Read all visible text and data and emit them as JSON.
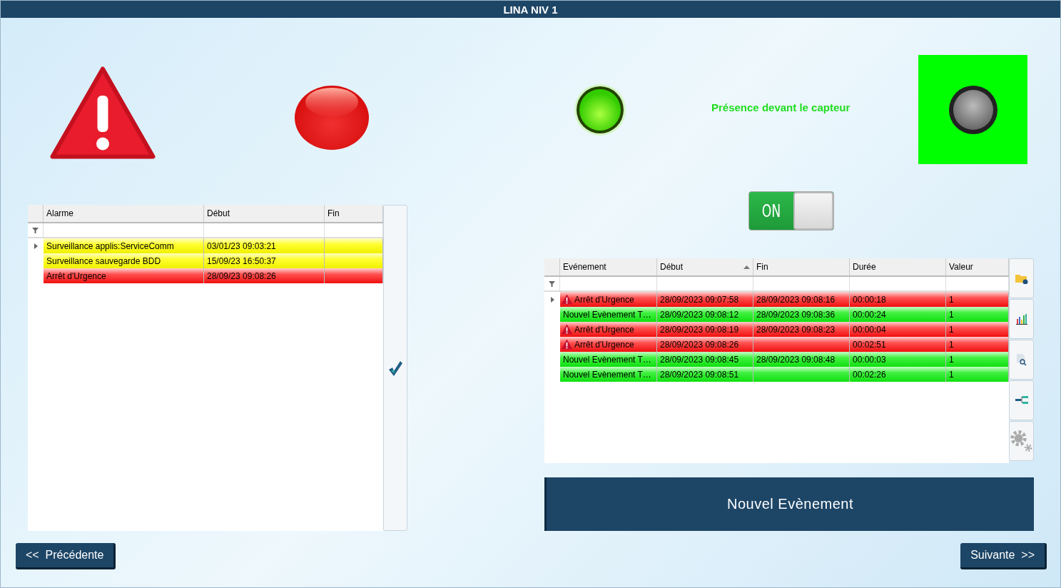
{
  "window": {
    "title": "LINA NIV 1"
  },
  "sensor": {
    "label": "Présence devant le capteur",
    "lit": true
  },
  "toggle": {
    "label": "ON",
    "on": true
  },
  "alarms": {
    "columns": [
      {
        "label": "Alarme"
      },
      {
        "label": "Début"
      },
      {
        "label": "Fin"
      }
    ],
    "rows": [
      {
        "kind": "warning",
        "cells": [
          "Surveillance applis:ServiceComm",
          "03/01/23 09:03:21",
          ""
        ]
      },
      {
        "kind": "warning",
        "cells": [
          "Surveillance sauvegarde BDD",
          "15/09/23 16:50:37",
          ""
        ]
      },
      {
        "kind": "alarm",
        "cells": [
          "Arrêt d'Urgence",
          "28/09/23 09:08:26",
          ""
        ]
      }
    ]
  },
  "events": {
    "columns": [
      {
        "label": "Evénement",
        "sorted": false
      },
      {
        "label": "Début",
        "sorted": true
      },
      {
        "label": "Fin",
        "sorted": false
      },
      {
        "label": "Durée",
        "sorted": false
      },
      {
        "label": "Valeur",
        "sorted": false
      }
    ],
    "rows": [
      {
        "kind": "alarm",
        "cells": [
          "Arrêt d'Urgence",
          "28/09/2023 09:07:58",
          "28/09/2023 09:08:16",
          "00:00:18",
          "1"
        ]
      },
      {
        "kind": "event",
        "cells": [
          "Nouvel Evènement T…",
          "28/09/2023 09:08:12",
          "28/09/2023 09:08:36",
          "00:00:24",
          "1"
        ]
      },
      {
        "kind": "alarm",
        "cells": [
          "Arrêt d'Urgence",
          "28/09/2023 09:08:19",
          "28/09/2023 09:08:23",
          "00:00:04",
          "1"
        ]
      },
      {
        "kind": "alarm",
        "cells": [
          "Arrêt d'Urgence",
          "28/09/2023 09:08:26",
          "",
          "00:02:51",
          "1"
        ]
      },
      {
        "kind": "event",
        "cells": [
          "Nouvel Evènement T…",
          "28/09/2023 09:08:45",
          "28/09/2023 09:08:48",
          "00:00:03",
          "1"
        ]
      },
      {
        "kind": "event",
        "cells": [
          "Nouvel Evènement T…",
          "28/09/2023 09:08:51",
          "",
          "00:02:26",
          "1"
        ]
      }
    ]
  },
  "new_event_button": "Nouvel Evènement",
  "nav": {
    "previous": "<<  Précédente",
    "next": "Suivante  >>"
  }
}
